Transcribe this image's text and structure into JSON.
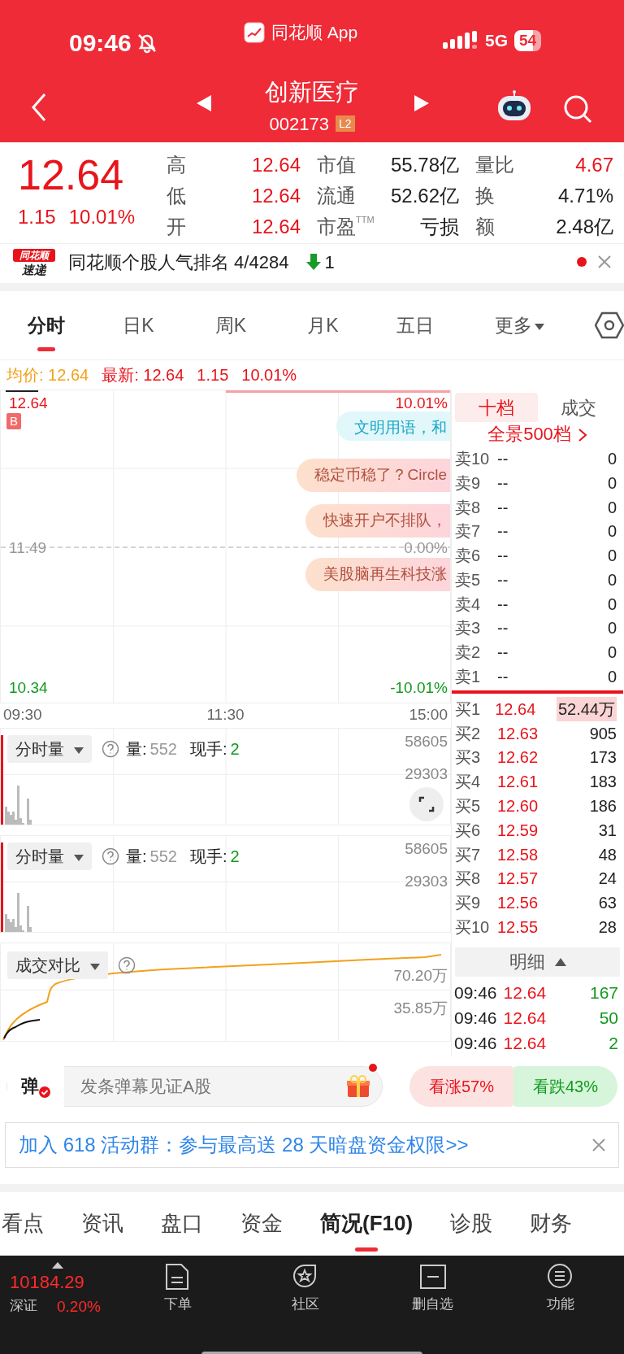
{
  "status_bar": {
    "time": "09:46",
    "app": "同花顺 App",
    "network": "5G",
    "battery": "54"
  },
  "header": {
    "title": "创新医疗",
    "code": "002173",
    "badge": "L2"
  },
  "quote": {
    "price": "12.64",
    "change": "1.15",
    "percent": "10.01%",
    "stats": [
      {
        "label": "高",
        "value": "12.64",
        "color": "#e8141b"
      },
      {
        "label": "市值",
        "value": "55.78亿",
        "color": "#222222"
      },
      {
        "label": "量比",
        "value": "4.67",
        "color": "#e8141b"
      },
      {
        "label": "低",
        "value": "12.64",
        "color": "#e8141b"
      },
      {
        "label": "流通",
        "value": "52.62亿",
        "color": "#222222"
      },
      {
        "label": "换",
        "value": "4.71%",
        "color": "#222222"
      },
      {
        "label": "开",
        "value": "12.64",
        "color": "#e8141b"
      },
      {
        "label": "市盈$^{TTM}$",
        "value": "亏损",
        "color": "#222222"
      },
      {
        "label": "额",
        "value": "2.48亿",
        "color": "#222222"
      }
    ]
  },
  "news": {
    "logo_top": "同花顺",
    "logo_bottom": "速递",
    "text": "同花顺个股人气排名 4/4284",
    "change": "1",
    "unread": true
  },
  "chart_tabs": [
    {
      "label": "分时",
      "selected": true
    },
    {
      "label": "日K",
      "selected": false
    },
    {
      "label": "周K",
      "selected": false
    },
    {
      "label": "月K",
      "selected": false
    },
    {
      "label": "五日",
      "selected": false
    },
    {
      "label": "更多",
      "selected": false,
      "dropdown": true
    }
  ],
  "info_line": [
    {
      "text": "均价: 12.64",
      "color": "#f3a11b"
    },
    {
      "text": "最新: 12.64",
      "color": "#e8141b"
    },
    {
      "text": "1.15",
      "color": "#e8141b"
    },
    {
      "text": "10.01%",
      "color": "#e8141b"
    }
  ],
  "price_chart": {
    "high": "12.64",
    "mid": "11.49",
    "low": "10.34",
    "high_pct": "10.01%",
    "mid_pct": "0.00%",
    "low_pct": "-10.01%",
    "marker": "B",
    "time_labels": [
      "09:30",
      "11:30",
      "15:00"
    ]
  },
  "danmaku": [
    {
      "text": "文明用语，和",
      "kind": "info"
    },
    {
      "text": "稳定币稳了？Circle",
      "kind": "promo"
    },
    {
      "text": "快速开户不排队，",
      "kind": "promo"
    },
    {
      "text": "美股脑再生科技涨",
      "kind": "promo"
    }
  ],
  "volume_panels": [
    {
      "selector": "分时量",
      "volume_label": "量:",
      "volume": "552",
      "hand_label": "现手:",
      "hand": "2",
      "axis": [
        "58605",
        "29303"
      ],
      "expand": true
    },
    {
      "selector": "分时量",
      "volume_label": "量:",
      "volume": "552",
      "hand_label": "现手:",
      "hand": "2",
      "axis": [
        "58605",
        "29303"
      ],
      "expand": false
    }
  ],
  "compare_panel": {
    "selector": "成交对比",
    "axis": [
      "70.20万",
      "35.85万"
    ]
  },
  "order_book": {
    "tabs": [
      {
        "label": "十档",
        "selected": true
      },
      {
        "label": "成交",
        "selected": false
      }
    ],
    "depth_link": "全景500档",
    "asks": [
      {
        "label": "卖10",
        "price": "--",
        "volume": "0"
      },
      {
        "label": "卖9",
        "price": "--",
        "volume": "0"
      },
      {
        "label": "卖8",
        "price": "--",
        "volume": "0"
      },
      {
        "label": "卖7",
        "price": "--",
        "volume": "0"
      },
      {
        "label": "卖6",
        "price": "--",
        "volume": "0"
      },
      {
        "label": "卖5",
        "price": "--",
        "volume": "0"
      },
      {
        "label": "卖4",
        "price": "--",
        "volume": "0"
      },
      {
        "label": "卖3",
        "price": "--",
        "volume": "0"
      },
      {
        "label": "卖2",
        "price": "--",
        "volume": "0"
      },
      {
        "label": "卖1",
        "price": "--",
        "volume": "0"
      }
    ],
    "bids": [
      {
        "label": "买1",
        "price": "12.64",
        "volume": "52.44万",
        "highlighted": true
      },
      {
        "label": "买2",
        "price": "12.63",
        "volume": "905",
        "highlighted": false
      },
      {
        "label": "买3",
        "price": "12.62",
        "volume": "173",
        "highlighted": false
      },
      {
        "label": "买4",
        "price": "12.61",
        "volume": "183",
        "highlighted": false
      },
      {
        "label": "买5",
        "price": "12.60",
        "volume": "186",
        "highlighted": false
      },
      {
        "label": "买6",
        "price": "12.59",
        "volume": "31",
        "highlighted": false
      },
      {
        "label": "买7",
        "price": "12.58",
        "volume": "48",
        "highlighted": false
      },
      {
        "label": "买8",
        "price": "12.57",
        "volume": "24",
        "highlighted": false
      },
      {
        "label": "买9",
        "price": "12.56",
        "volume": "63",
        "highlighted": false
      },
      {
        "label": "买10",
        "price": "12.55",
        "volume": "28",
        "highlighted": false
      }
    ],
    "detail_header": "明细",
    "trades": [
      {
        "time": "09:46",
        "price": "12.64",
        "volume": "167"
      },
      {
        "time": "09:46",
        "price": "12.64",
        "volume": "50"
      },
      {
        "time": "09:46",
        "price": "12.64",
        "volume": "2"
      }
    ]
  },
  "danmaku_bar": {
    "badge": "弹",
    "placeholder": "发条弹幕见证A股",
    "gift_dot": true
  },
  "sentiment": [
    {
      "label": "看涨57%",
      "kind": "bull"
    },
    {
      "label": "看跌43%",
      "kind": "bear"
    }
  ],
  "banner": {
    "text": "加入 618 活动群：参与最高送 28 天暗盘资金权限>>"
  },
  "section_tabs": [
    {
      "label": "看点",
      "selected": false
    },
    {
      "label": "资讯",
      "selected": false
    },
    {
      "label": "盘口",
      "selected": false
    },
    {
      "label": "资金",
      "selected": false
    },
    {
      "label": "简况(F10)",
      "selected": true
    },
    {
      "label": "诊股",
      "selected": false
    },
    {
      "label": "财务",
      "selected": false
    }
  ],
  "bottom_nav": {
    "index": {
      "value": "10184.29",
      "name": "深证",
      "percent": "0.20%"
    },
    "items": [
      {
        "label": "下单",
        "kind": "order"
      },
      {
        "label": "社区",
        "kind": "community"
      },
      {
        "label": "删自选",
        "kind": "remove"
      },
      {
        "label": "功能",
        "kind": "menu"
      }
    ]
  }
}
